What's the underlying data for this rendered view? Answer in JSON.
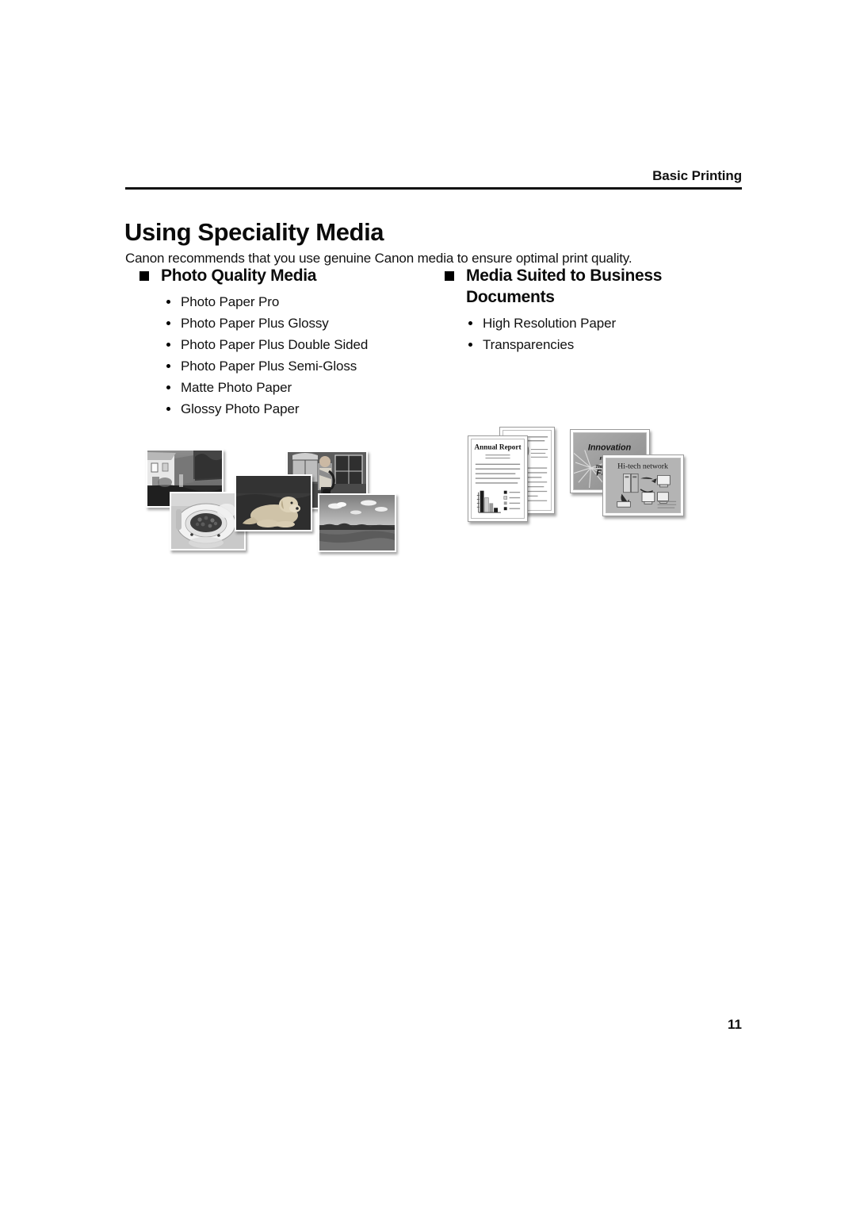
{
  "header": {
    "running_head": "Basic Printing"
  },
  "title": "Using Speciality Media",
  "intro": "Canon recommends that you use genuine Canon media to ensure optimal print quality.",
  "sections": [
    {
      "heading": "Photo Quality Media",
      "items": [
        "Photo Paper Pro",
        "Photo Paper Plus Glossy",
        "Photo Paper Plus Double Sided",
        "Photo Paper Plus Semi-Gloss",
        "Matte Photo Paper",
        "Glossy Photo Paper"
      ]
    },
    {
      "heading": "Media Suited to Business Documents",
      "items": [
        "High Resolution Paper",
        "Transparencies"
      ]
    }
  ],
  "illustrations": {
    "photo_collage": {
      "caption_names": [
        "house-photo",
        "plate-of-food-photo",
        "dog-photo",
        "saxophone-player-photo",
        "landscape-field-photo"
      ]
    },
    "business_documents": {
      "annual_report_title": "Annual Report",
      "slide_innovation_lines": [
        "Innovation",
        "For",
        "The",
        "Future"
      ],
      "slide_network_title": "Hi-tech network"
    }
  },
  "folio": "11"
}
